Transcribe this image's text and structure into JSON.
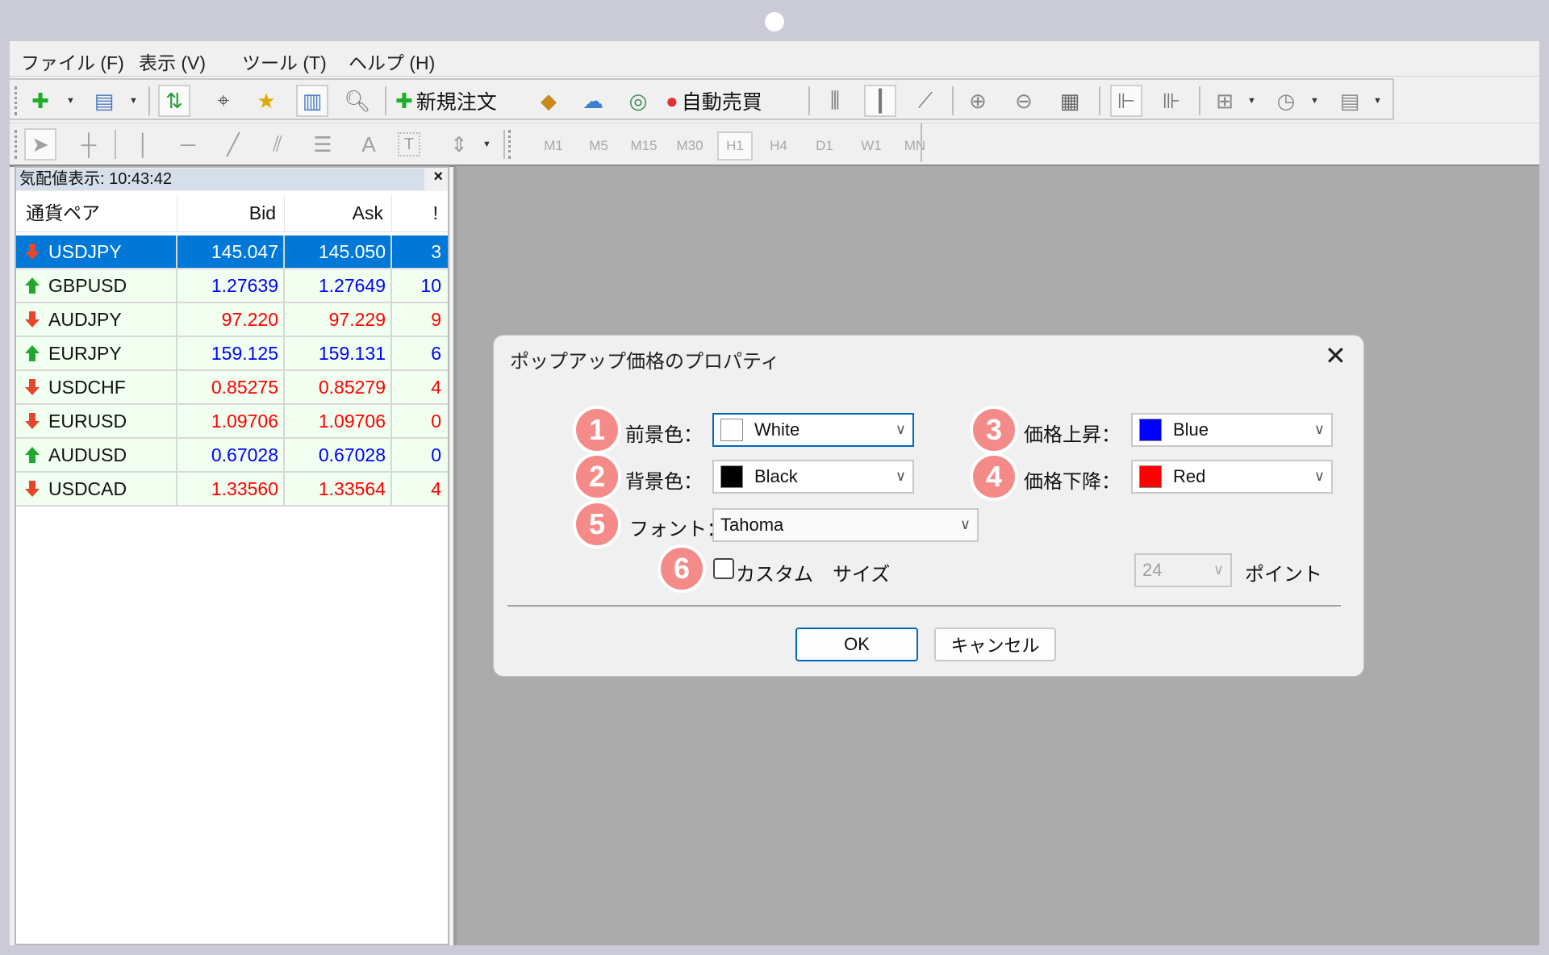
{
  "menu": [
    "ファイル (F)",
    "表示 (V)",
    "ツール (T)",
    "ヘルプ (H)"
  ],
  "toolbar1": {
    "new_order_label": "新規注文",
    "auto_trade_label": "自動売買"
  },
  "toolbar2": {
    "timeframes": [
      "M1",
      "M5",
      "M15",
      "M30",
      "H1",
      "H4",
      "D1",
      "W1",
      "MN"
    ],
    "active_timeframe": "H1",
    "text_tool": "A",
    "text_label_tool": "T"
  },
  "market_watch": {
    "title": "気配値表示: 10:43:42",
    "close": "×",
    "columns": [
      "通貨ペア",
      "Bid",
      "Ask",
      "!"
    ],
    "rows": [
      {
        "symbol": "USDJPY",
        "bid": "145.047",
        "ask": "145.050",
        "spread": "3",
        "dir": "down",
        "selected": true
      },
      {
        "symbol": "GBPUSD",
        "bid": "1.27639",
        "ask": "1.27649",
        "spread": "10",
        "dir": "up"
      },
      {
        "symbol": "AUDJPY",
        "bid": "97.220",
        "ask": "97.229",
        "spread": "9",
        "dir": "down"
      },
      {
        "symbol": "EURJPY",
        "bid": "159.125",
        "ask": "159.131",
        "spread": "6",
        "dir": "up"
      },
      {
        "symbol": "USDCHF",
        "bid": "0.85275",
        "ask": "0.85279",
        "spread": "4",
        "dir": "down"
      },
      {
        "symbol": "EURUSD",
        "bid": "1.09706",
        "ask": "1.09706",
        "spread": "0",
        "dir": "down"
      },
      {
        "symbol": "AUDUSD",
        "bid": "0.67028",
        "ask": "0.67028",
        "spread": "0",
        "dir": "up"
      },
      {
        "symbol": "USDCAD",
        "bid": "1.33560",
        "ask": "1.33564",
        "spread": "4",
        "dir": "down"
      }
    ],
    "colors": {
      "up": "#0000ff",
      "down": "#ff0000",
      "selected": "#0078d7"
    }
  },
  "dialog": {
    "title": "ポップアップ価格のプロパティ",
    "close": "✕",
    "foreground": {
      "badge": "1",
      "label": "前景色：",
      "value": "White",
      "color": "#ffffff"
    },
    "background": {
      "badge": "2",
      "label": "背景色：",
      "value": "Black",
      "color": "#000000"
    },
    "price_up": {
      "badge": "3",
      "label": "価格上昇：",
      "value": "Blue",
      "color": "#0000ff"
    },
    "price_down": {
      "badge": "4",
      "label": "価格下降：",
      "value": "Red",
      "color": "#ff0000"
    },
    "font": {
      "badge": "5",
      "label": "フォント：",
      "value": "Tahoma"
    },
    "custom_size": {
      "badge": "6",
      "label": "カスタム　サイズ",
      "checked": false,
      "size": "24",
      "unit": "ポイント"
    },
    "ok": "OK",
    "cancel": "キャンセル"
  }
}
